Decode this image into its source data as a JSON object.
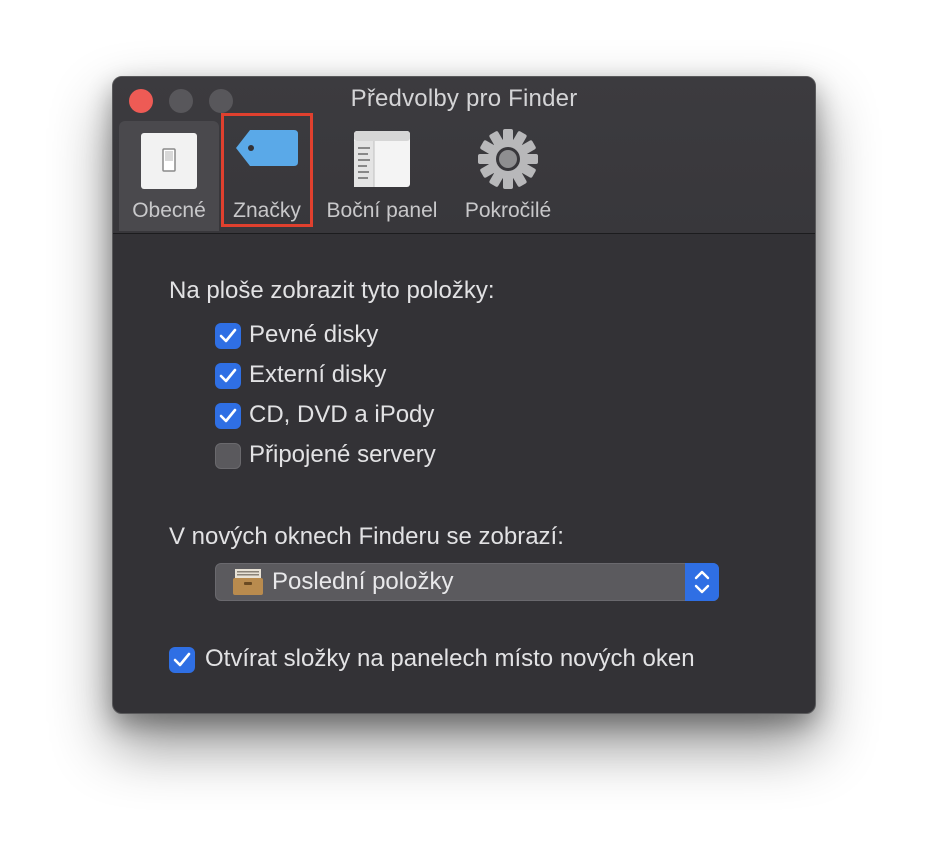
{
  "window": {
    "title": "Předvolby pro Finder"
  },
  "tabs": [
    {
      "label": "Obecné",
      "icon": "light-switch-icon"
    },
    {
      "label": "Značky",
      "icon": "tag-icon"
    },
    {
      "label": "Boční panel",
      "icon": "sidebar-icon"
    },
    {
      "label": "Pokročilé",
      "icon": "gear-icon"
    }
  ],
  "desktop_section": {
    "heading": "Na ploše zobrazit tyto položky:",
    "items": [
      {
        "label": "Pevné disky",
        "checked": true
      },
      {
        "label": "Externí disky",
        "checked": true
      },
      {
        "label": "CD, DVD a iPody",
        "checked": true
      },
      {
        "label": "Připojené servery",
        "checked": false
      }
    ]
  },
  "new_window": {
    "heading": "V nových oknech Finderu se zobrazí:",
    "selected": "Poslední položky",
    "icon": "recents-icon"
  },
  "tabs_option": {
    "label": "Otvírat složky na panelech místo nových oken",
    "checked": true
  },
  "colors": {
    "accent": "#2f6fe4",
    "highlight_border": "#e0402e",
    "close_button": "#ee5b55"
  }
}
